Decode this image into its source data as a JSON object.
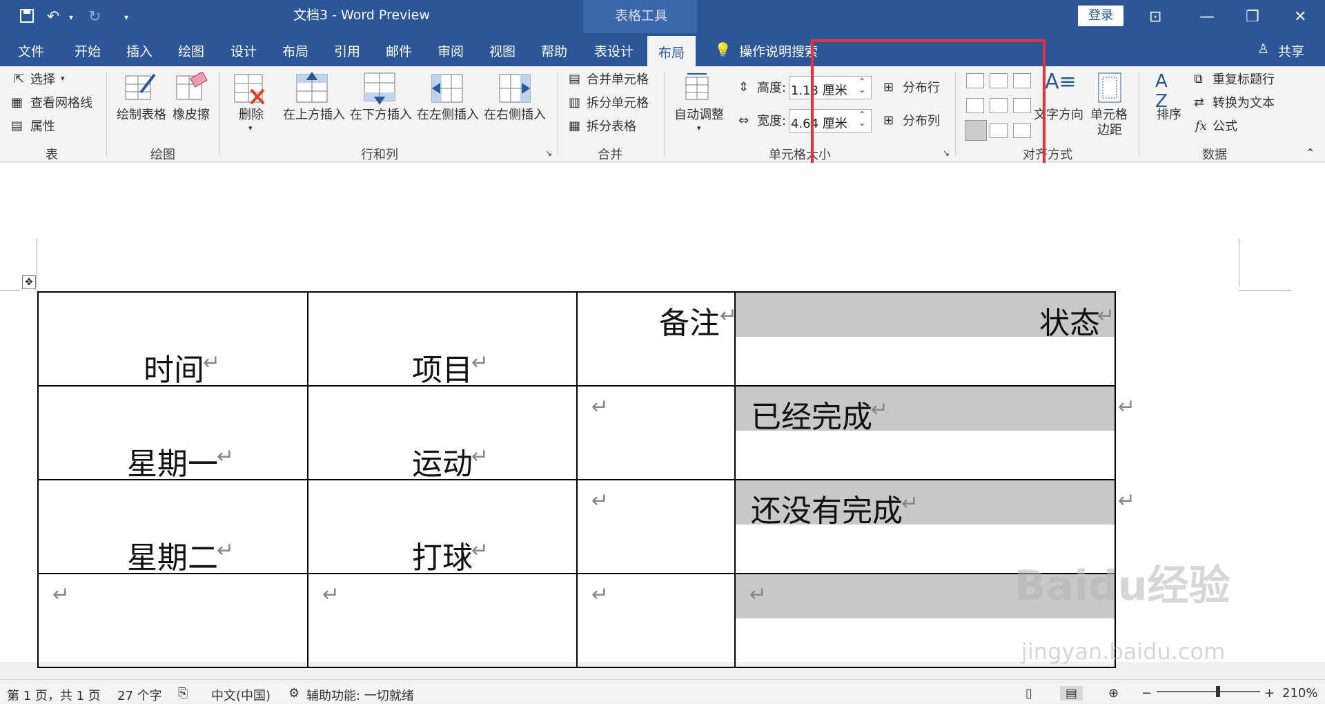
{
  "titlebar": {
    "doc_title": "文档3  -  Word Preview",
    "context_tab": "表格工具",
    "login": "登录"
  },
  "tabs": [
    "文件",
    "开始",
    "插入",
    "绘图",
    "设计",
    "布局",
    "引用",
    "邮件",
    "审阅",
    "视图",
    "帮助",
    "表设计",
    "布局"
  ],
  "active_tab": "布局",
  "tellme": "操作说明搜索",
  "share": "共享",
  "ribbon": {
    "table_group": {
      "select": "选择",
      "gridlines": "查看网格线",
      "properties": "属性",
      "label": "表"
    },
    "draw_group": {
      "draw_table": "绘制表格",
      "eraser": "橡皮擦",
      "label": "绘图"
    },
    "rows_group": {
      "delete": "删除",
      "insert_above": "在上方插入",
      "insert_below": "在下方插入",
      "insert_left": "在左侧插入",
      "insert_right": "在右侧插入",
      "label": "行和列"
    },
    "merge_group": {
      "merge": "合并单元格",
      "split_cells": "拆分单元格",
      "split_table": "拆分表格",
      "label": "合并"
    },
    "size_group": {
      "autofit": "自动调整",
      "height_label": "高度:",
      "height_value": "1.13 厘米",
      "width_label": "宽度:",
      "width_value": "4.64 厘米",
      "distribute_rows": "分布行",
      "distribute_cols": "分布列",
      "label": "单元格大小"
    },
    "align_group": {
      "text_direction": "文字方向",
      "cell_margins_1": "单元格",
      "cell_margins_2": "边距",
      "label": "对齐方式"
    },
    "data_group": {
      "sort": "排序",
      "repeat_header": "重复标题行",
      "convert": "转换为文本",
      "formula": "公式",
      "label": "数据"
    }
  },
  "table": {
    "rows": [
      [
        "时间",
        "项目",
        "备注",
        "状态"
      ],
      [
        "星期一",
        "运动",
        "",
        "已经完成"
      ],
      [
        "星期二",
        "打球",
        "",
        "还没有完成"
      ],
      [
        "",
        "",
        "",
        ""
      ]
    ]
  },
  "status": {
    "page": "第 1 页，共 1 页",
    "words": "27 个字",
    "lang": "中文(中国)",
    "access": "辅助功能: 一切就绪",
    "zoom": "210%"
  },
  "watermark": {
    "brand": "Baidu经验",
    "url": "jingyan.baidu.com"
  }
}
